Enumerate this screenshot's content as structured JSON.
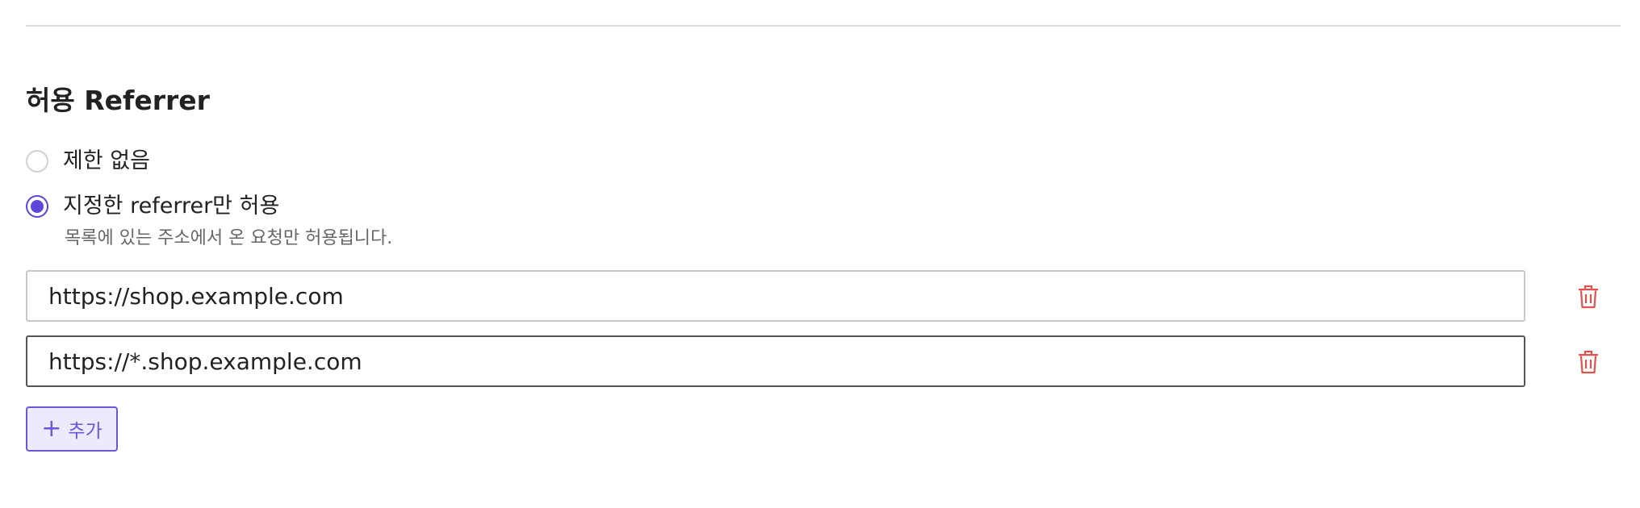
{
  "section": {
    "title": "허용 Referrer"
  },
  "options": [
    {
      "label": "제한 없음",
      "selected": false
    },
    {
      "label": "지정한 referrer만 허용",
      "selected": true,
      "help": "목록에 있는 주소에서 온 요청만 허용됩니다."
    }
  ],
  "referrers": [
    {
      "value": "https://shop.example.com"
    },
    {
      "value": "https://*.shop.example.com"
    }
  ],
  "actions": {
    "add_label": "추가",
    "add_icon": "plus-icon",
    "delete_icon": "trash-icon"
  },
  "colors": {
    "accent": "#5b46d9",
    "delete": "#e0524d",
    "add_background": "#ecebfd"
  }
}
